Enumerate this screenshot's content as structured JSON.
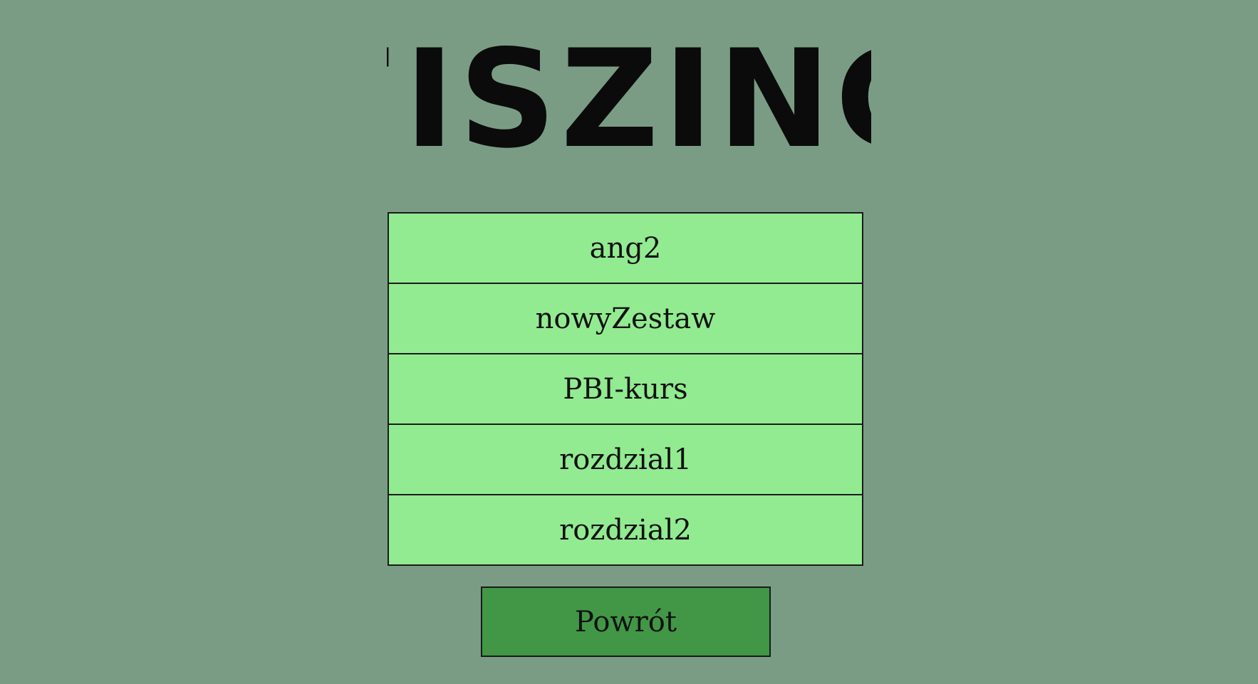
{
  "app": {
    "title": "FISZING"
  },
  "sets": [
    {
      "label": "ang2"
    },
    {
      "label": "nowyZestaw"
    },
    {
      "label": "PBI-kurs"
    },
    {
      "label": "rozdzial1"
    },
    {
      "label": "rozdzial2"
    }
  ],
  "back_button": {
    "label": "Powrót"
  },
  "colors": {
    "background": "#7a9c85",
    "list_item": "#92eb90",
    "back_button": "#419746",
    "text": "#111111"
  }
}
